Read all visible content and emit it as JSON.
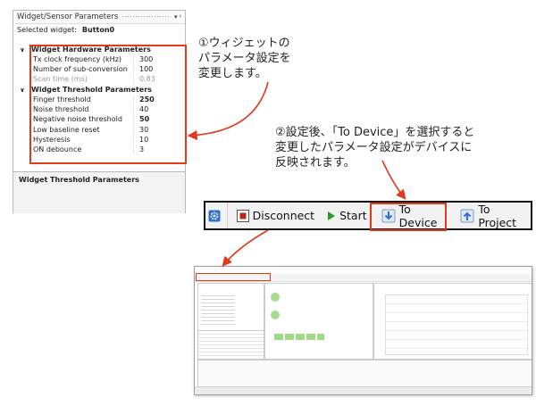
{
  "panel": {
    "title": "Widget/Sensor Parameters",
    "selected_widget_label": "Selected widget:",
    "selected_widget_value": "Button0",
    "hardware_category": "Widget Hardware Parameters",
    "hardware_params": [
      {
        "name": "Tx clock frequency (kHz)",
        "value": "300",
        "disabled": false,
        "bold": false
      },
      {
        "name": "Number of sub-conversion",
        "value": "100",
        "disabled": false,
        "bold": false
      },
      {
        "name": "Scan time (ms)",
        "value": "0.83",
        "disabled": true,
        "bold": false
      }
    ],
    "threshold_category": "Widget Threshold Parameters",
    "threshold_params": [
      {
        "name": "Finger threshold",
        "value": "250",
        "disabled": false,
        "bold": true
      },
      {
        "name": "Noise threshold",
        "value": "40",
        "disabled": false,
        "bold": false
      },
      {
        "name": "Negative noise threshold",
        "value": "50",
        "disabled": false,
        "bold": true
      },
      {
        "name": "Low baseline reset",
        "value": "30",
        "disabled": false,
        "bold": false
      },
      {
        "name": "Hysteresis",
        "value": "10",
        "disabled": false,
        "bold": false
      },
      {
        "name": "ON debounce",
        "value": "3",
        "disabled": false,
        "bold": false
      }
    ],
    "description_title": "Widget Threshold Parameters"
  },
  "annotations": {
    "note1": [
      "①ウィジェットの",
      "パラメータ設定を",
      "変更します。"
    ],
    "note2": [
      "②設定後、「To Device」を選択すると",
      "変更したパラメータ設定がデバイスに",
      "反映されます。"
    ]
  },
  "toolbar": {
    "settings_icon": "gear-icon",
    "disconnect_label": "Disconnect",
    "start_label": "Start",
    "to_device_label": "To Device",
    "to_project_label": "To Project"
  },
  "colors": {
    "highlight": "#e2391c",
    "accent_green": "#a6dc8e",
    "accent_blue": "#2f6fd0"
  }
}
